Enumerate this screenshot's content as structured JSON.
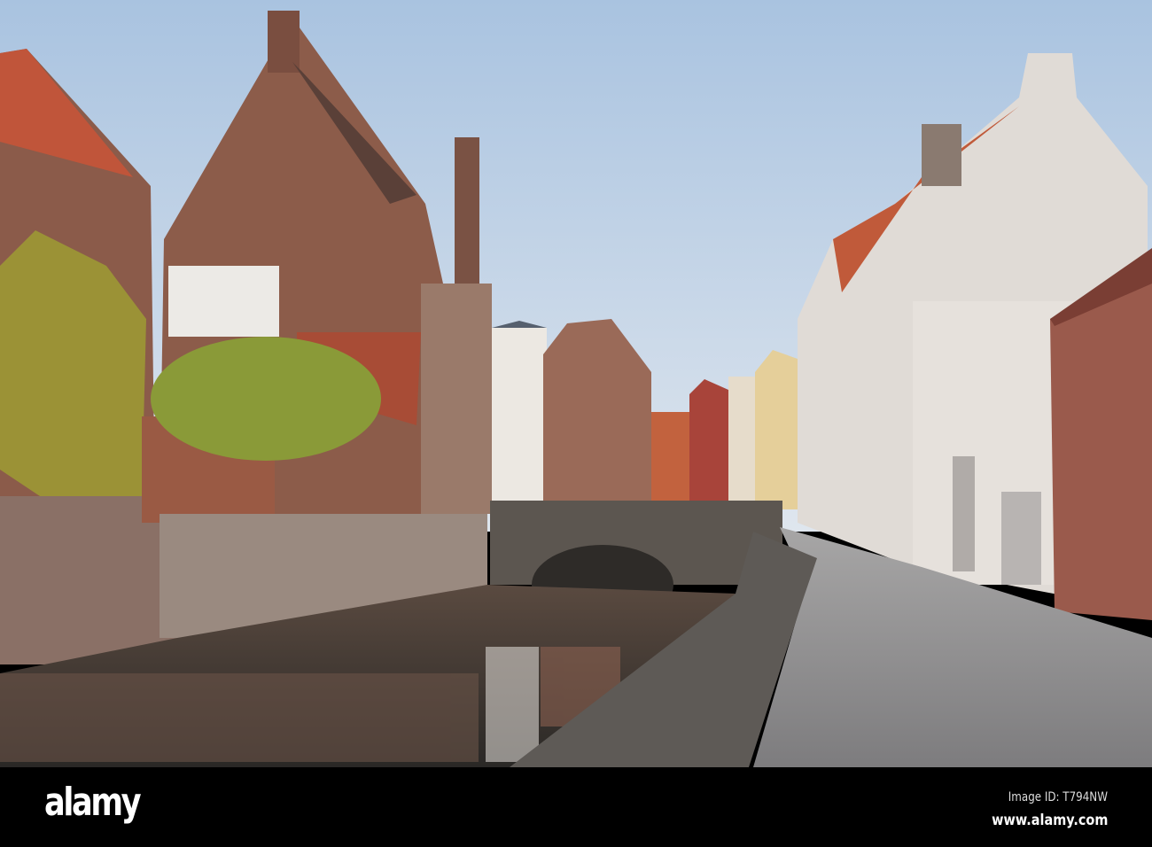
{
  "footer": {
    "logo": "alamy",
    "image_id": "Image ID: T794NW",
    "website": "www.alamy.com"
  },
  "colors": {
    "sky": "#b9cde3",
    "brick": "#8a5a48",
    "roof": "#b8553a",
    "whitewash": "#e2ddd7",
    "water": "#3d3a36",
    "cobble": "#8e8e90",
    "ivy": "#9a9a30"
  }
}
